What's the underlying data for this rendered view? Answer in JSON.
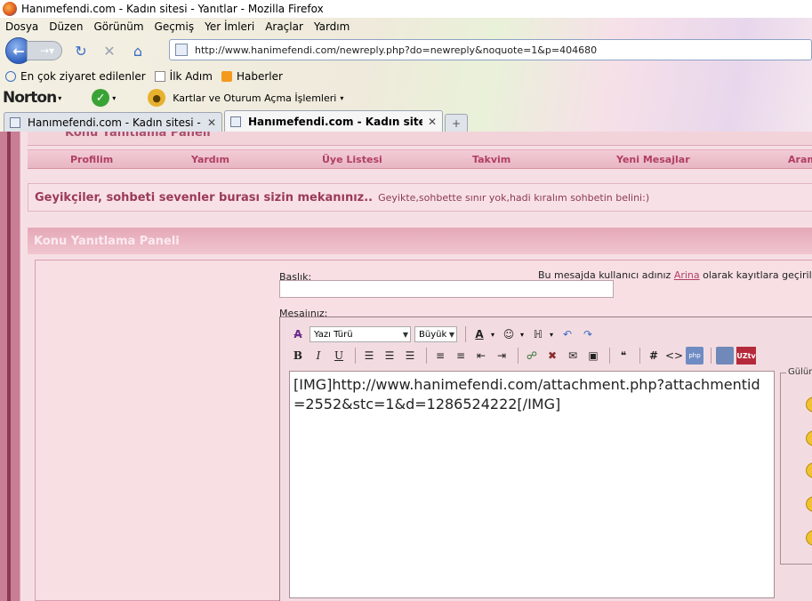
{
  "window": {
    "title": "Hanımefendi.com - Kadın sitesi - Yanıtlar - Mozilla Firefox"
  },
  "menu": [
    "Dosya",
    "Düzen",
    "Görünüm",
    "Geçmiş",
    "Yer İmleri",
    "Araçlar",
    "Yardım"
  ],
  "address": {
    "url": "http://www.hanimefendi.com/newreply.php?do=newreply&noquote=1&p=404680"
  },
  "bookmarks": [
    "En çok ziyaret edilenler",
    "İlk Adım",
    "Haberler"
  ],
  "norton": {
    "logo": "Norton",
    "cards_label": "Kartlar ve Oturum Açma İşlemleri"
  },
  "tabs": [
    {
      "label": "Hanımefendi.com - Kadın sitesi - Ki..."
    },
    {
      "label": "Hanımefendi.com - Kadın sitesi - ..."
    }
  ],
  "site": {
    "old_panel_title": "Konu Yanıtlama Paneli",
    "nav": [
      "Profilim",
      "Yardım",
      "Üye Listesi",
      "Takvim",
      "Yeni Mesajlar",
      "Aram"
    ],
    "banner_bold": "Geyikçiler, sohbeti sevenler burası sizin mekanınız..",
    "banner_text": "Geyikte,sohbette sınır yok,hadi kıralım sohbetin belini:)",
    "panel_title": "Konu Yanıtlama Paneli",
    "title_label": "Başlık:",
    "user_info_pre": "Bu mesajda kullanıcı adınız",
    "user_name": "Arina",
    "user_info_post": "olarak kayıtlara geçirile",
    "message_label": "Mesajınız:",
    "font_select": "Yazı Türü",
    "size_select": "Büyük",
    "message_text": "[IMG]http://www.hanimefendi.com/attachment.php?attachmentid=2552&stc=1&d=1286524222[/IMG]",
    "smilies_label": "Gülüm",
    "uztv_label": "UZtv"
  }
}
